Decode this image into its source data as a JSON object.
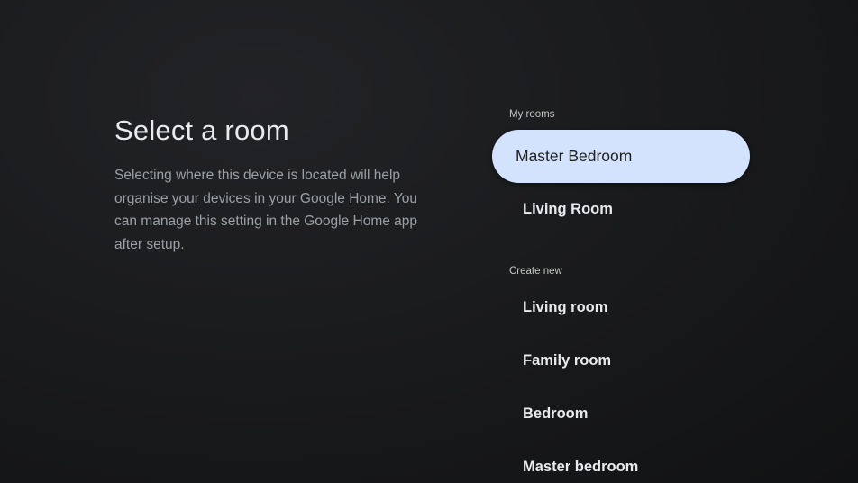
{
  "header": {
    "title": "Select a room",
    "description": "Selecting where this device is located will help organise your devices in your Google Home. You can manage this setting in the Google Home app after setup."
  },
  "my_rooms": {
    "label": "My rooms",
    "items": [
      {
        "label": "Master Bedroom",
        "focused": true
      },
      {
        "label": "Living Room",
        "focused": false
      }
    ]
  },
  "create_new": {
    "label": "Create new",
    "items": [
      {
        "label": "Living room"
      },
      {
        "label": "Family room"
      },
      {
        "label": "Bedroom"
      },
      {
        "label": "Master bedroom"
      }
    ]
  },
  "colors": {
    "background": "#1a1b1d",
    "focus_pill": "#d3e3fd",
    "text_primary": "#e8eaed",
    "text_secondary": "#9aa0a6"
  }
}
